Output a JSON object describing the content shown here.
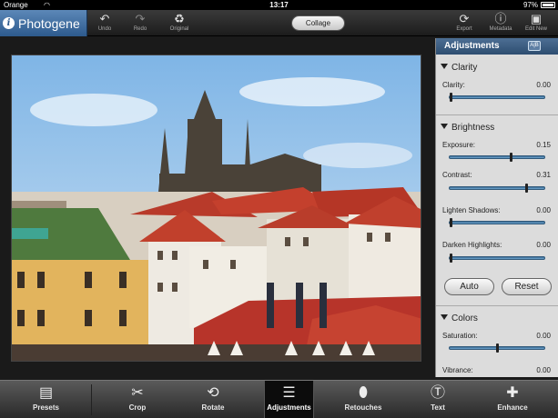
{
  "status_bar": {
    "carrier": "Orange",
    "time": "13:17",
    "battery": "97%"
  },
  "toolbar": {
    "app_name": "Photogene",
    "undo_label": "Undo",
    "redo_label": "Redo",
    "original_label": "Original",
    "collage_label": "Collage",
    "export_label": "Export",
    "metadata_label": "Metadata",
    "edit_new_label": "Edit New"
  },
  "panel": {
    "title": "Adjustments",
    "sections": {
      "clarity": {
        "title": "Clarity",
        "rows": [
          {
            "label": "Clarity:",
            "value": "0.00",
            "position": 0.0
          }
        ]
      },
      "brightness": {
        "title": "Brightness",
        "rows": [
          {
            "label": "Exposure:",
            "value": "0.15",
            "position": 0.65
          },
          {
            "label": "Contrast:",
            "value": "0.31",
            "position": 0.82
          },
          {
            "label": "Lighten Shadows:",
            "value": "0.00",
            "position": 0.0
          },
          {
            "label": "Darken Highlights:",
            "value": "0.00",
            "position": 0.0
          }
        ]
      },
      "colors": {
        "title": "Colors",
        "rows": [
          {
            "label": "Saturation:",
            "value": "0.00",
            "position": 0.5
          },
          {
            "label": "Vibrance:",
            "value": "0.00",
            "position": 0.5
          }
        ]
      }
    },
    "auto_label": "Auto",
    "reset_label": "Reset"
  },
  "tabs": [
    {
      "label": "Presets",
      "icon": "presets-icon"
    },
    {
      "label": "Crop",
      "icon": "scissors-icon"
    },
    {
      "label": "Rotate",
      "icon": "rotate-icon"
    },
    {
      "label": "Adjustments",
      "icon": "sliders-icon"
    },
    {
      "label": "Retouches",
      "icon": "bandage-icon"
    },
    {
      "label": "Text",
      "icon": "text-bubble-icon"
    },
    {
      "label": "Enhance",
      "icon": "enhance-icon"
    }
  ],
  "active_tab": "Adjustments"
}
